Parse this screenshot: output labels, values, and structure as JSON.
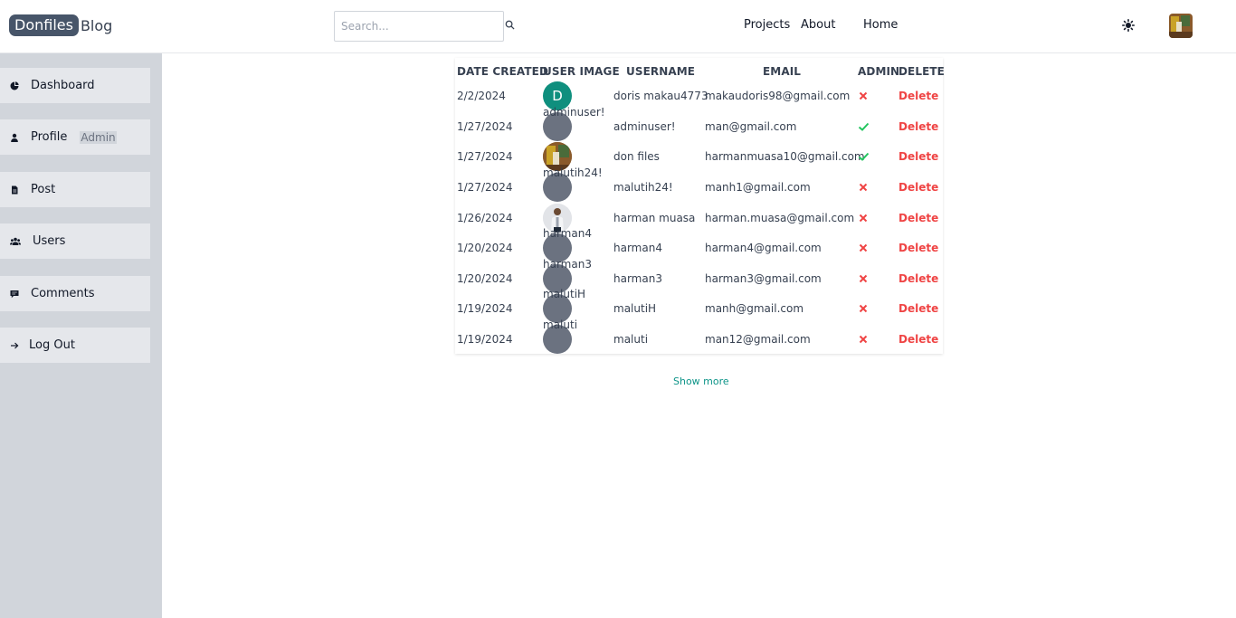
{
  "header": {
    "logo_brand": "Donfiles",
    "logo_suffix": "Blog",
    "search_placeholder": "Search...",
    "nav": [
      "Projects",
      "About",
      "Home"
    ]
  },
  "sidebar": {
    "items": [
      {
        "label": "Dashboard",
        "icon": "pie-chart-icon"
      },
      {
        "label": "Profile",
        "icon": "user-icon",
        "badge": "Admin"
      },
      {
        "label": "Post",
        "icon": "document-icon"
      },
      {
        "label": "Users",
        "icon": "users-icon"
      },
      {
        "label": "Comments",
        "icon": "comment-icon"
      },
      {
        "label": "Log Out",
        "icon": "arrow-right-icon"
      }
    ]
  },
  "table": {
    "headers": [
      "DATE CREATED",
      "USER IMAGE",
      "USERNAME",
      "EMAIL",
      "ADMIN",
      "DELETE"
    ],
    "rows": [
      {
        "date": "2/2/2024",
        "image": "letter-avatar",
        "letter": "D",
        "alt": "",
        "username": "doris makau4773",
        "email": "makaudoris98@gmail.com",
        "admin": false,
        "delete": "Delete"
      },
      {
        "date": "1/27/2024",
        "image": "broken",
        "letter": "",
        "alt": "adminuser!",
        "username": "adminuser!",
        "email": "man@gmail.com",
        "admin": true,
        "delete": "Delete"
      },
      {
        "date": "1/27/2024",
        "image": "photo-avatar",
        "letter": "",
        "alt": "",
        "username": "don files",
        "email": "harmanmuasa10@gmail.com",
        "admin": true,
        "delete": "Delete"
      },
      {
        "date": "1/27/2024",
        "image": "broken",
        "letter": "",
        "alt": "malutih24!",
        "username": "malutih24!",
        "email": "manh1@gmail.com",
        "admin": false,
        "delete": "Delete"
      },
      {
        "date": "1/26/2024",
        "image": "person-photo",
        "letter": "",
        "alt": "",
        "username": "harman muasa",
        "email": "harman.muasa@gmail.com",
        "admin": false,
        "delete": "Delete"
      },
      {
        "date": "1/20/2024",
        "image": "broken",
        "letter": "",
        "alt": "harman4",
        "username": "harman4",
        "email": "harman4@gmail.com",
        "admin": false,
        "delete": "Delete"
      },
      {
        "date": "1/20/2024",
        "image": "broken",
        "letter": "",
        "alt": "harman3",
        "username": "harman3",
        "email": "harman3@gmail.com",
        "admin": false,
        "delete": "Delete"
      },
      {
        "date": "1/19/2024",
        "image": "broken",
        "letter": "",
        "alt": "malutiH",
        "username": "malutiH",
        "email": "manh@gmail.com",
        "admin": false,
        "delete": "Delete"
      },
      {
        "date": "1/19/2024",
        "image": "broken",
        "letter": "",
        "alt": "maluti",
        "username": "maluti",
        "email": "man12@gmail.com",
        "admin": false,
        "delete": "Delete"
      }
    ],
    "show_more": "Show more"
  },
  "colors": {
    "accent": "#0d9488",
    "admin_yes": "#22c55e",
    "admin_no": "#ef4444",
    "sidebar_bg": "#d1d5db"
  }
}
